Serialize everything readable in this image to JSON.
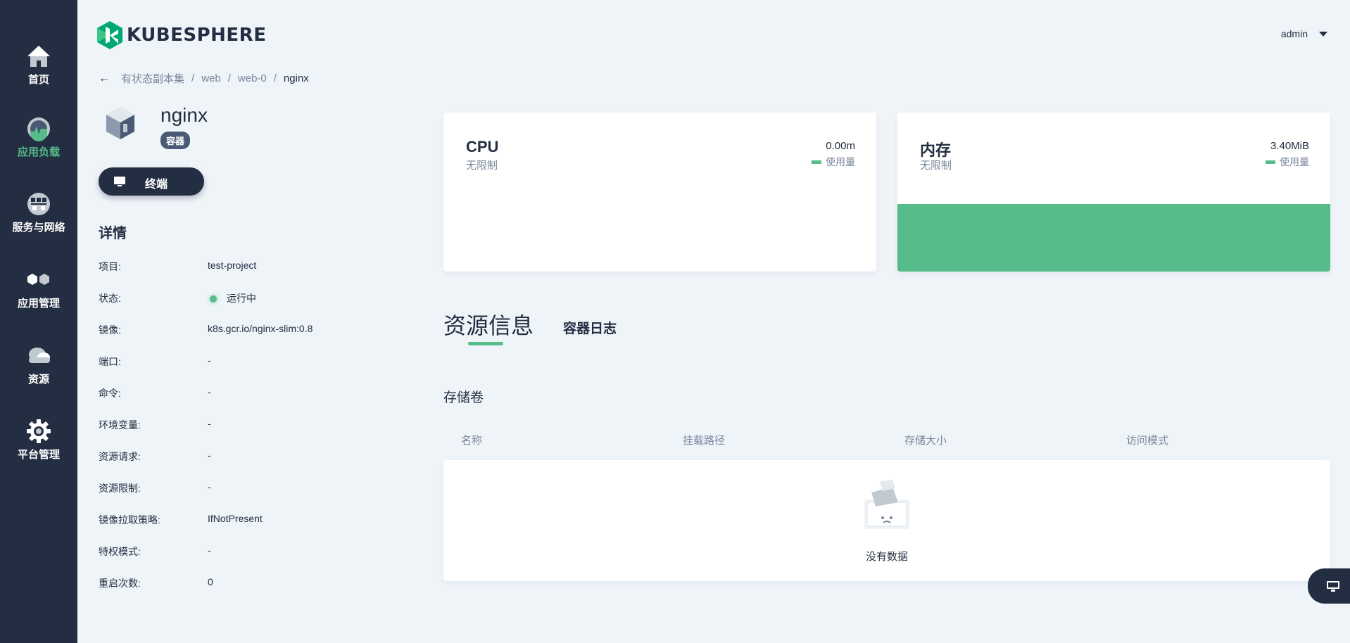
{
  "sidebar": {
    "items": [
      {
        "label": "首页",
        "icon": "home-icon"
      },
      {
        "label": "应用负载",
        "icon": "dashboard-gauge-icon"
      },
      {
        "label": "服务与网络",
        "icon": "network-globe-icon"
      },
      {
        "label": "应用管理",
        "icon": "hexagon-apps-icon"
      },
      {
        "label": "资源",
        "icon": "cloud-icon"
      },
      {
        "label": "平台管理",
        "icon": "gear-icon"
      }
    ],
    "active_color": "#55bc8a"
  },
  "header": {
    "logo_text": "KUBESPHERE",
    "user": "admin"
  },
  "breadcrumb": {
    "back_icon": "←",
    "items": [
      "有状态副本集",
      "web",
      "web-0",
      "nginx"
    ],
    "separator": "/"
  },
  "container": {
    "name": "nginx",
    "badge": "容器",
    "terminal_button": "终端"
  },
  "details": {
    "title": "详情",
    "rows": [
      {
        "key": "项目:",
        "value": "test-project"
      },
      {
        "key": "状态:",
        "value": "运行中",
        "status_color": "#55bc8a"
      },
      {
        "key": "镜像:",
        "value": "k8s.gcr.io/nginx-slim:0.8"
      },
      {
        "key": "端口:",
        "value": "-"
      },
      {
        "key": "命令:",
        "value": "-"
      },
      {
        "key": "环境变量:",
        "value": "-"
      },
      {
        "key": "资源请求:",
        "value": "-"
      },
      {
        "key": "资源限制:",
        "value": "-"
      },
      {
        "key": "镜像拉取策略:",
        "value": "IfNotPresent"
      },
      {
        "key": "特权模式:",
        "value": "-"
      },
      {
        "key": "重启次数:",
        "value": "0"
      }
    ]
  },
  "metrics": {
    "cpu": {
      "title": "CPU",
      "subtitle": "无限制",
      "value": "0.00m",
      "legend": "使用量"
    },
    "memory": {
      "title": "内存",
      "subtitle": "无限制",
      "value": "3.40MiB",
      "legend": "使用量"
    }
  },
  "tabs": {
    "active": "资源信息",
    "other": "容器日志"
  },
  "volumes": {
    "title": "存储卷",
    "columns": [
      "名称",
      "挂载路径",
      "存储大小",
      "访问模式"
    ],
    "empty_text": "没有数据"
  },
  "colors": {
    "sidebar_bg": "#242e42",
    "accent": "#55bc8a",
    "page_bg": "#eff4f9"
  }
}
